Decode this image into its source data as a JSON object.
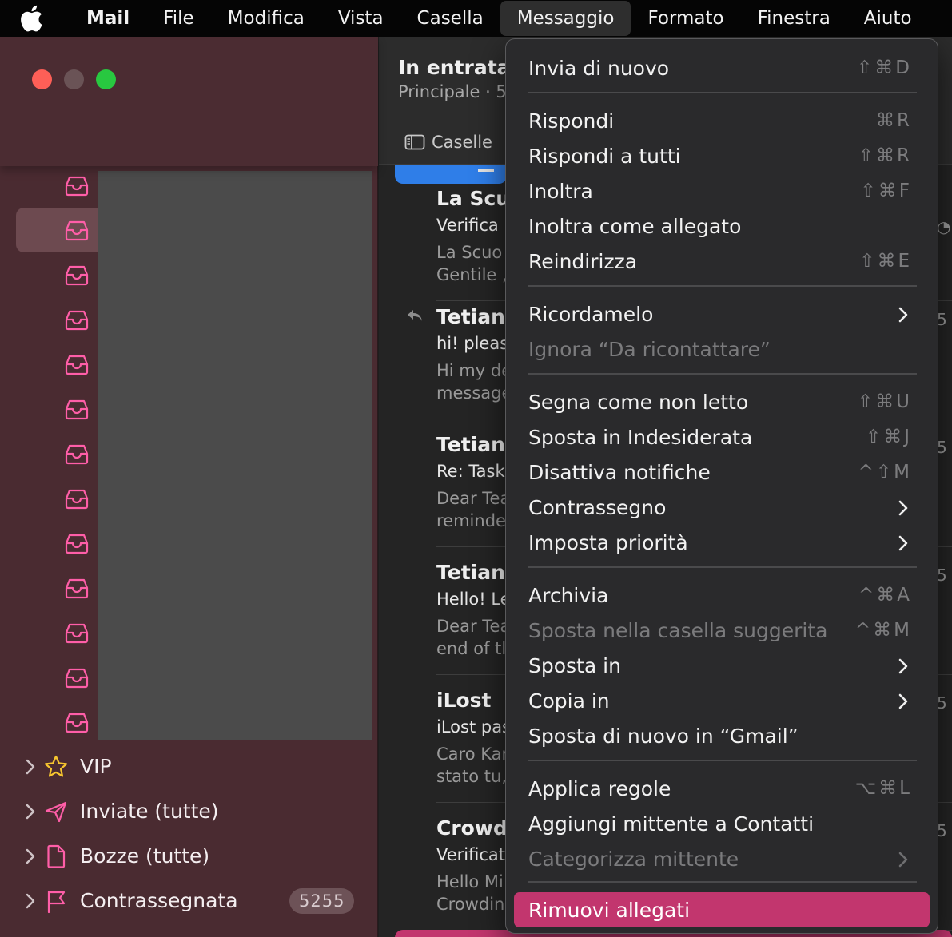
{
  "menubar": {
    "app_name": "Mail",
    "items": [
      "File",
      "Modifica",
      "Vista",
      "Casella",
      "Messaggio",
      "Formato",
      "Finestra",
      "Aiuto"
    ],
    "active_item": "Messaggio"
  },
  "sidebar": {
    "smart_mailboxes": [
      {
        "label": "VIP",
        "icon": "star-icon"
      },
      {
        "label": "Inviate (tutte)",
        "icon": "paper-plane-icon"
      },
      {
        "label": "Bozze (tutte)",
        "icon": "document-icon"
      },
      {
        "label": "Contrassegnata",
        "icon": "flag-icon",
        "badge": "5255"
      }
    ],
    "accent_color": "#ff5ea8"
  },
  "message_list": {
    "title": "In entrata",
    "subtitle": "Principale · 5",
    "caselle_label": "Caselle",
    "emails": [
      {
        "sender": "La Scu",
        "subject": "Verifica",
        "preview1": "La Scuo",
        "preview2": "Gentile ,"
      },
      {
        "sender": "Tetiana",
        "subject": "hi! pleas",
        "preview1": "Hi my de",
        "preview2": "message",
        "replied": true
      },
      {
        "sender": "Tetiana",
        "subject": "Re: Task",
        "preview1": "Dear Tea",
        "preview2": "reminde"
      },
      {
        "sender": "Tetiana",
        "subject": "Hello! Le",
        "preview1": "Dear Tea",
        "preview2": "end of tl"
      },
      {
        "sender": "iLost",
        "subject": "iLost pas",
        "preview1": "Caro Kar",
        "preview2": "stato tu,"
      },
      {
        "sender": "Crowdi",
        "subject": "Verificat",
        "preview1": "Hello Mi",
        "preview2": "Crowdin"
      }
    ]
  },
  "message_menu": {
    "items": [
      {
        "label": "Invia di nuovo",
        "shortcut": "⇧⌘D"
      },
      {
        "label": "Rispondi",
        "shortcut": "⌘R"
      },
      {
        "label": "Rispondi a tutti",
        "shortcut": "⇧⌘R"
      },
      {
        "label": "Inoltra",
        "shortcut": "⇧⌘F"
      },
      {
        "label": "Inoltra come allegato",
        "shortcut": ""
      },
      {
        "label": "Reindirizza",
        "shortcut": "⇧⌘E"
      },
      {
        "label": "Ricordamelo",
        "submenu": true
      },
      {
        "label": "Ignora “Da ricontattare”",
        "disabled": true
      },
      {
        "label": "Segna come non letto",
        "shortcut": "⇧⌘U"
      },
      {
        "label": "Sposta in Indesiderata",
        "shortcut": "⇧⌘J"
      },
      {
        "label": "Disattiva notifiche",
        "shortcut": "^⇧M"
      },
      {
        "label": "Contrassegno",
        "submenu": true
      },
      {
        "label": "Imposta priorità",
        "submenu": true
      },
      {
        "label": "Archivia",
        "shortcut": "^⌘A"
      },
      {
        "label": "Sposta nella casella suggerita",
        "shortcut": "^⌘M",
        "disabled": true
      },
      {
        "label": "Sposta in",
        "submenu": true
      },
      {
        "label": "Copia in",
        "submenu": true
      },
      {
        "label": "Sposta di nuovo in “Gmail”",
        "shortcut": ""
      },
      {
        "label": "Applica regole",
        "shortcut": "⌥⌘L"
      },
      {
        "label": "Aggiungi mittente a Contatti",
        "shortcut": ""
      },
      {
        "label": "Categorizza mittente",
        "submenu": true,
        "disabled": true
      },
      {
        "label": "Rimuovi allegati",
        "highlighted": true
      }
    ],
    "highlight_color": "#c2366e"
  }
}
